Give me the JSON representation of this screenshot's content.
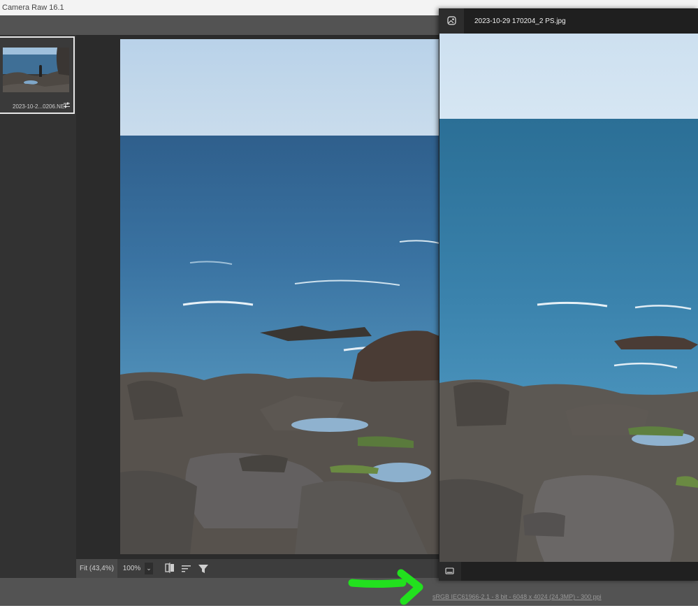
{
  "window": {
    "title": "Camera Raw 16.1"
  },
  "filmstrip": {
    "items": [
      {
        "name": "2023-10-2...0206.NEF",
        "adjust_icon": "sliders-icon"
      }
    ]
  },
  "viewer": {
    "title": "2023-10-29 170204_2 PS.jpg",
    "header_icon": "image-icon",
    "footer_icon": "filmstrip-toggle-icon"
  },
  "bottom_bar": {
    "zoom_fit": "Fit (43,4%)",
    "zoom_100": "100%",
    "zoom_dropdown_icon": "chevron-down-icon",
    "icons": [
      "compare-icon",
      "sort-icon",
      "filter-icon"
    ]
  },
  "status": {
    "text": "sRGB IEC61966-2.1 - 8 bit - 6048 x 4024 (24,3MP) - 300 ppi"
  },
  "annotation": {
    "color": "#22e01e"
  }
}
